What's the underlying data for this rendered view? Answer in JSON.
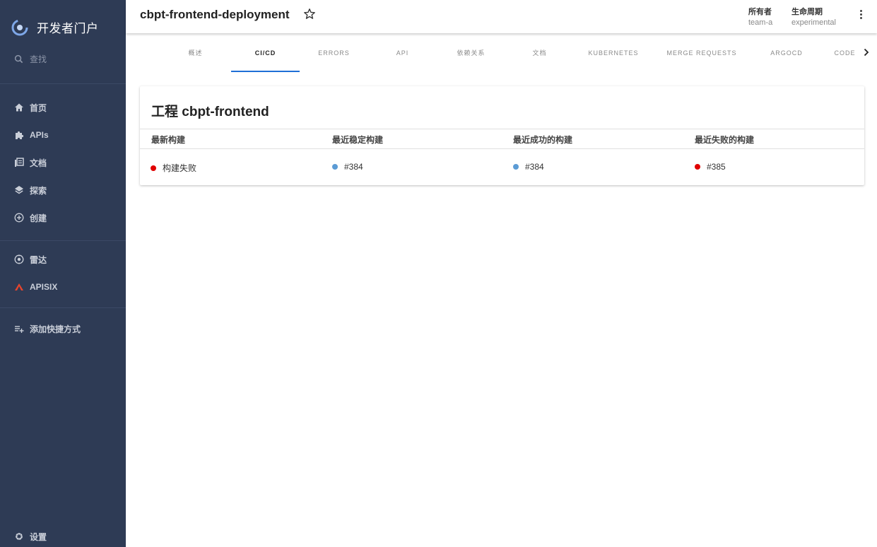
{
  "sidebar": {
    "brand": "开发者门户",
    "search": "查找",
    "items": [
      {
        "label": "首页",
        "icon": "home-icon"
      },
      {
        "label": "APIs",
        "icon": "puzzle-icon"
      },
      {
        "label": "文档",
        "icon": "library-icon"
      },
      {
        "label": "探索",
        "icon": "layers-icon"
      },
      {
        "label": "创建",
        "icon": "add-circle-icon"
      }
    ],
    "items2": [
      {
        "label": "雷达",
        "icon": "radar-icon"
      },
      {
        "label": "APISIX",
        "icon": "apisix-icon"
      }
    ],
    "shortcut": "添加快捷方式",
    "settings": "设置"
  },
  "header": {
    "title": "cbpt-frontend-deployment",
    "owner_label": "所有者",
    "owner_value": "team-a",
    "lifecycle_label": "生命周期",
    "lifecycle_value": "experimental"
  },
  "tabs": [
    "概述",
    "CI/CD",
    "ERRORS",
    "API",
    "依赖关系",
    "文档",
    "KUBERNETES",
    "MERGE REQUESTS",
    "ARGOCD",
    "CODE"
  ],
  "active_tab": "CI/CD",
  "card": {
    "title": "工程 cbpt-frontend",
    "columns": [
      "最新构建",
      "最近稳定构建",
      "最近成功的构建",
      "最近失败的构建"
    ],
    "cells": [
      {
        "text": "构建失败",
        "status": "failed"
      },
      {
        "text": "#384",
        "status": "info"
      },
      {
        "text": "#384",
        "status": "info"
      },
      {
        "text": "#385",
        "status": "failed"
      }
    ]
  },
  "colors": {
    "sidebar_bg": "#2e3b55",
    "accent": "#1f6fd6",
    "status_failed": "#e00000",
    "status_info": "#5b9bd5"
  }
}
